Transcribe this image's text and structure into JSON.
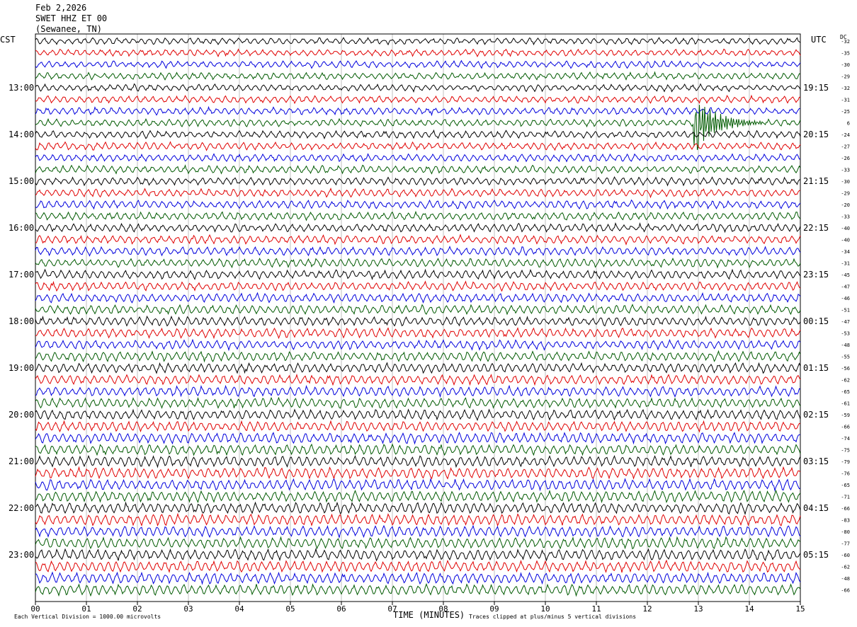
{
  "header": {
    "date": "Feb 2,2026",
    "station": "SWET HHZ ET 00",
    "location": "(Sewanee, TN)"
  },
  "left_timezone": "CST",
  "right_timezone": "UTC",
  "dc_label": "DC",
  "footer": {
    "scale_note": "Each Vertical Division = 1000.00 microvolts",
    "clip_note": "Traces clipped at plus/minus 5 vertical divisions"
  },
  "colors": {
    "row0": "#000000",
    "row1": "#e00000",
    "row2": "#0000dd",
    "row3": "#005a00"
  },
  "chart_data": {
    "type": "line",
    "xlabel": "TIME (MINUTES)",
    "x_ticks": [
      "00",
      "01",
      "02",
      "03",
      "04",
      "05",
      "06",
      "07",
      "08",
      "09",
      "10",
      "11",
      "12",
      "13",
      "14",
      "15"
    ],
    "xlim": [
      0,
      15
    ],
    "rows": 48,
    "left_hour_labels": [
      "13:00",
      "14:00",
      "15:00",
      "16:00",
      "17:00",
      "18:00",
      "19:00",
      "20:00",
      "21:00",
      "22:00",
      "23:00"
    ],
    "right_hour_labels": [
      "19:15",
      "20:15",
      "21:15",
      "22:15",
      "23:15",
      "00:15",
      "01:15",
      "02:15",
      "03:15",
      "04:15",
      "05:15"
    ],
    "dc_offsets": [
      -32,
      -35,
      -30,
      -29,
      -32,
      -31,
      -25,
      6,
      -24,
      -27,
      -26,
      -33,
      -30,
      -29,
      -20,
      -33,
      -40,
      -40,
      -34,
      -31,
      -45,
      -47,
      -46,
      -51,
      -47,
      -53,
      -48,
      -55,
      -56,
      -62,
      -65,
      -61,
      -59,
      -66,
      -74,
      -75,
      -79,
      -76,
      -65,
      -71,
      -66,
      -83,
      -80,
      -77,
      -60,
      -62,
      -48,
      -66
    ],
    "events": [
      {
        "row": 7,
        "start_min": 12.9,
        "end_min": 14.3,
        "note": "large earthquake signal"
      }
    ]
  }
}
